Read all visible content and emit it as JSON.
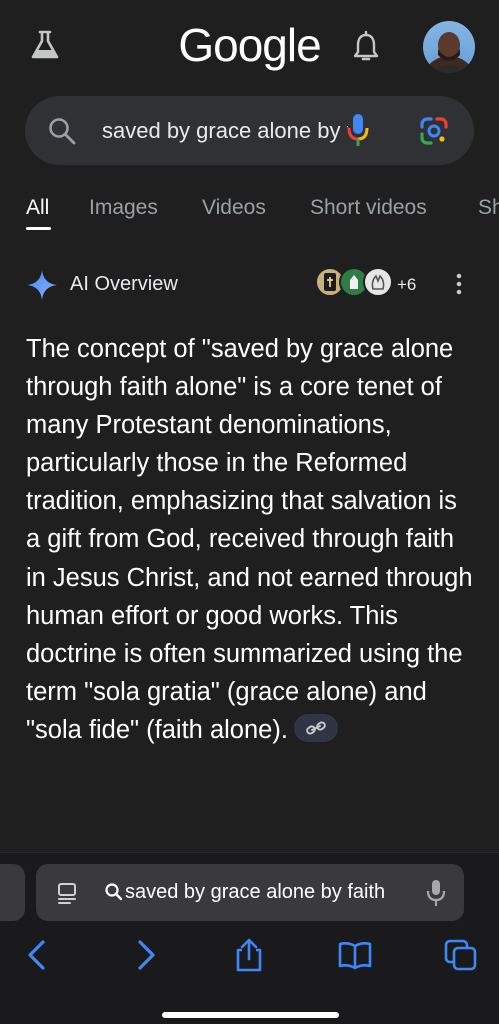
{
  "header": {
    "logo_text": "Google",
    "labs_icon": "flask-icon",
    "notification_icon": "bell-icon",
    "avatar_icon": "profile-avatar"
  },
  "search": {
    "query": "saved by grace alone by faith"
  },
  "tabs": [
    {
      "label": "All",
      "active": true
    },
    {
      "label": "Images"
    },
    {
      "label": "Videos"
    },
    {
      "label": "Short videos"
    },
    {
      "label": "Sh"
    }
  ],
  "ai_overview": {
    "title": "AI Overview",
    "source_count": "+6",
    "body": "The concept of \"saved by grace alone through faith alone\" is a core tenet of many Protestant denominations, particularly those in the Reformed tradition, emphasizing that salvation is a gift from God, received through faith in Jesus Christ, and not earned through human effort or good works. This doctrine is often summarized using the term \"sola gratia\" (grace alone) and \"sola fide\" (faith alone)."
  },
  "browser": {
    "address_text": "saved by grace alone by faith",
    "accent": "#3e87f7"
  }
}
